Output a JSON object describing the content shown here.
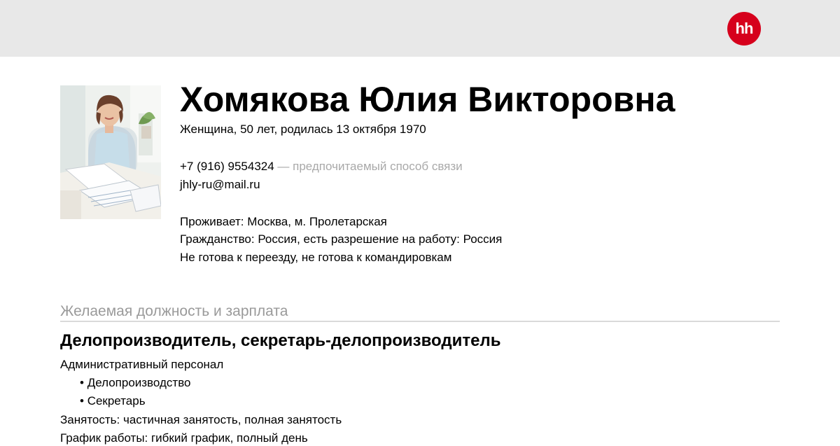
{
  "brand": {
    "logo_text": "hh",
    "logo_color": "#d6001c",
    "topbar_color": "#e8e8e8"
  },
  "person": {
    "name": "Хомякова Юлия Викторовна",
    "summary": "Женщина, 50 лет, родилась 13 октября 1970",
    "phone": "+7 (916) 9554324",
    "phone_note": " — предпочитаемый способ связи",
    "email": "jhly-ru@mail.ru",
    "residence": "Проживает: Москва, м. Пролетарская",
    "citizenship": "Гражданство: Россия, есть разрешение на работу: Россия",
    "relocation": "Не готова к переезду, не готова к командировкам"
  },
  "desired_position": {
    "section_title": "Желаемая должность и зарплата",
    "title": "Делопроизводитель, секретарь-делопроизводитель",
    "area": "Административный персонал",
    "specializations": [
      "Делопроизводство",
      "Секретарь"
    ],
    "bullet": "•",
    "employment": "Занятость: частичная занятость, полная занятость",
    "schedule": "График работы: гибкий график, полный день"
  }
}
